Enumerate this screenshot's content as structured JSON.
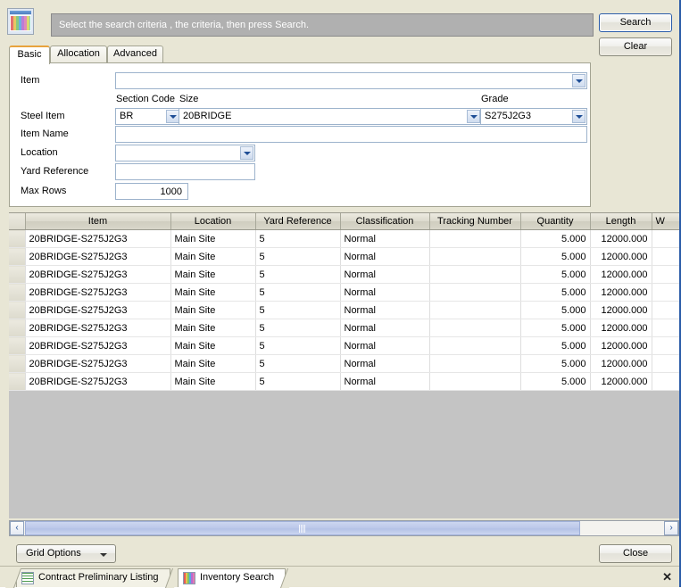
{
  "window": {
    "app_icon": "color-grid-window-icon",
    "message": "Select the search criteria , the criteria, then press Search."
  },
  "toolbar": {
    "search_label": "Search",
    "clear_label": "Clear"
  },
  "tabs": [
    {
      "label": "Basic",
      "active": true
    },
    {
      "label": "Allocation",
      "active": false
    },
    {
      "label": "Advanced",
      "active": false
    }
  ],
  "form": {
    "item": {
      "label": "Item",
      "value": "",
      "type": "combo"
    },
    "section_code": {
      "label": "Section Code",
      "value": "BR"
    },
    "size": {
      "label": "Size",
      "value": "20BRIDGE"
    },
    "grade": {
      "label": "Grade",
      "value": "S275J2G3"
    },
    "steel_item": {
      "label": "Steel Item"
    },
    "item_name": {
      "label": "Item Name",
      "value": ""
    },
    "location": {
      "label": "Location",
      "value": ""
    },
    "yard_reference": {
      "label": "Yard Reference",
      "value": ""
    },
    "max_rows": {
      "label": "Max Rows",
      "value": "1000"
    }
  },
  "grid": {
    "columns": [
      "Item",
      "Location",
      "Yard Reference",
      "Classification",
      "Tracking Number",
      "Quantity",
      "Length",
      "W"
    ],
    "rows": [
      [
        "20BRIDGE-S275J2G3",
        "Main Site",
        "5",
        "Normal",
        "",
        "5.000",
        "12000.000",
        ""
      ],
      [
        "20BRIDGE-S275J2G3",
        "Main Site",
        "5",
        "Normal",
        "",
        "5.000",
        "12000.000",
        ""
      ],
      [
        "20BRIDGE-S275J2G3",
        "Main Site",
        "5",
        "Normal",
        "",
        "5.000",
        "12000.000",
        ""
      ],
      [
        "20BRIDGE-S275J2G3",
        "Main Site",
        "5",
        "Normal",
        "",
        "5.000",
        "12000.000",
        ""
      ],
      [
        "20BRIDGE-S275J2G3",
        "Main Site",
        "5",
        "Normal",
        "",
        "5.000",
        "12000.000",
        ""
      ],
      [
        "20BRIDGE-S275J2G3",
        "Main Site",
        "5",
        "Normal",
        "",
        "5.000",
        "12000.000",
        ""
      ],
      [
        "20BRIDGE-S275J2G3",
        "Main Site",
        "5",
        "Normal",
        "",
        "5.000",
        "12000.000",
        ""
      ],
      [
        "20BRIDGE-S275J2G3",
        "Main Site",
        "5",
        "Normal",
        "",
        "5.000",
        "12000.000",
        ""
      ],
      [
        "20BRIDGE-S275J2G3",
        "Main Site",
        "5",
        "Normal",
        "",
        "5.000",
        "12000.000",
        ""
      ]
    ]
  },
  "scrollbar": {
    "left_arrow": "‹",
    "right_arrow": "›"
  },
  "bottom": {
    "grid_options_label": "Grid Options",
    "close_label": "Close"
  },
  "doc_tabs": [
    {
      "label": "Contract Preliminary Listing",
      "icon": "document-icon",
      "active": false
    },
    {
      "label": "Inventory Search",
      "icon": "color-grid-icon",
      "active": true
    }
  ],
  "doc_tabs_close": "✕"
}
